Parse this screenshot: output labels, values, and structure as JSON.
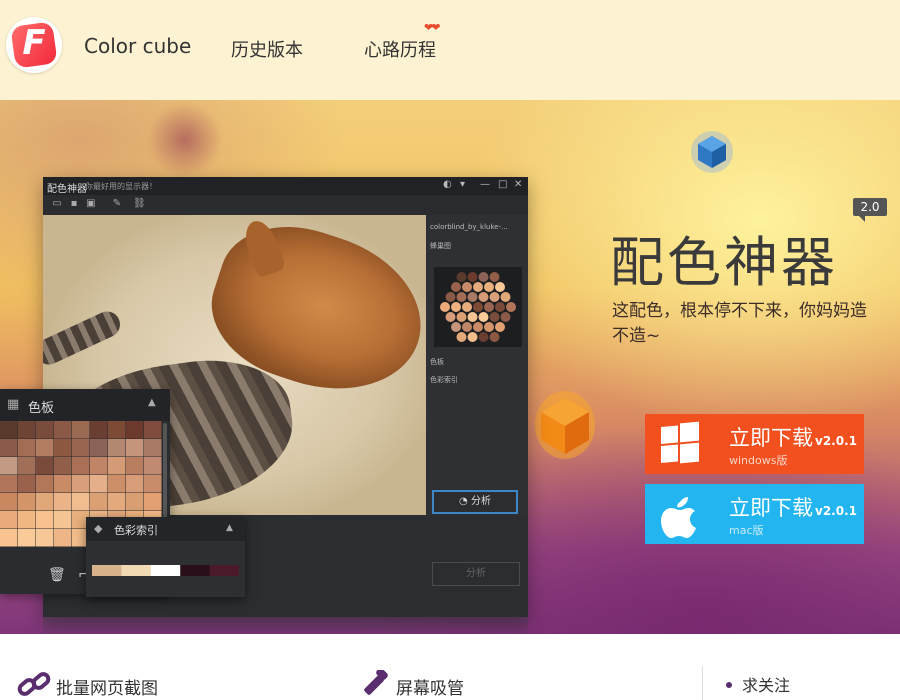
{
  "header": {
    "logo_letter": "F",
    "brand": "Color cube",
    "nav": [
      {
        "label": "历史版本"
      },
      {
        "label": "心路历程"
      }
    ],
    "hearts": "❤❤"
  },
  "hero": {
    "version_badge": "2.0",
    "title": "配色神器",
    "tagline": "这配色，根本停不下来，你妈妈造不造~",
    "downloads": [
      {
        "label": "立即下载",
        "version": "v2.0.1",
        "platform": "windows版",
        "color": "#f2501e",
        "icon": "windows-icon"
      },
      {
        "label": "立即下载",
        "version": "v2.0.1",
        "platform": "mac版",
        "color": "#22b5f0",
        "icon": "apple-icon"
      }
    ]
  },
  "app_window": {
    "title": "配色神器",
    "subtitle": "你最好用的显示器！",
    "file_label": "colorblind_by_kluke-...",
    "panel_honeycomb": "蜂巢图",
    "panel_palette": "色板",
    "panel_color_index": "色彩索引",
    "analyze_button": "分析",
    "ghost_button": "分析"
  },
  "palette_panel": {
    "title": "色板",
    "colors": [
      "#5b3a2e",
      "#6e4535",
      "#7a4c3b",
      "#8a5a47",
      "#9b6a52",
      "#6a3e30",
      "#7d4a36",
      "#6b3a2c",
      "#7e4b3d",
      "#8c5a48",
      "#a36d55",
      "#b17c5f",
      "#8d5842",
      "#9a6550",
      "#8b6358",
      "#b48770",
      "#c4957a",
      "#a87a66",
      "#c39a84",
      "#a16f58",
      "#7a4a3a",
      "#915e4a",
      "#a96f57",
      "#c08566",
      "#d59b76",
      "#b97e60",
      "#c08b72",
      "#b1755a",
      "#9a624c",
      "#b27658",
      "#c98a66",
      "#d8a07a",
      "#e5b089",
      "#cd8f67",
      "#d89c78",
      "#c98c6a",
      "#c98860",
      "#d49668",
      "#e0a778",
      "#eab488",
      "#f1bd8f",
      "#dba073",
      "#e4a97d",
      "#d99f73",
      "#e3a173",
      "#eaaa79",
      "#f1b783",
      "#f6c18f",
      "#f4c593",
      "#e8b07d",
      "#efb787",
      "#e4a97b",
      "#f0b27e",
      "#f4ba86",
      "#f8c38f",
      "#f9cb98",
      "#f6c896",
      "#eeb687",
      "#f2bd8b",
      "#e8ad7d"
    ],
    "footer_icons": [
      "trash-icon",
      "crop-icon"
    ]
  },
  "color_index_panel": {
    "title": "色彩索引",
    "bar_colors": [
      "#d8b28a",
      "#f1d9b4",
      "#ffffff",
      "#2a0f1a",
      "#4a1a2a"
    ]
  },
  "features": [
    {
      "icon": "link-icon",
      "label": "批量网页截图"
    },
    {
      "icon": "eyedropper-icon",
      "label": "屏幕吸管"
    }
  ],
  "follow": {
    "label": "求关注"
  },
  "colors": {
    "header_bg": "#fdf3d2",
    "windows_orange": "#f2501e",
    "mac_blue": "#22b5f0"
  }
}
